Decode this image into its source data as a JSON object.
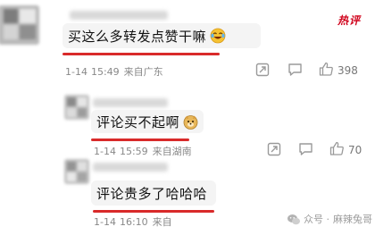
{
  "hot_badge": "热评",
  "comments": [
    {
      "text": "买这么多转发点赞干嘛",
      "date": "1-14",
      "time": "15:49",
      "location": "来自广东",
      "likes": "398",
      "emoji": "laughing-crying-emoji"
    },
    {
      "text": "评论买不起啊",
      "date": "1-14",
      "time": "15:59",
      "location": "来自湖南",
      "likes": "70",
      "emoji": "doge-emoji"
    },
    {
      "text": "评论贵多了哈哈哈",
      "date": "1-14",
      "time": "16:10",
      "location": "来自",
      "likes": ""
    }
  ],
  "watermark": {
    "prefix": "众号 ·",
    "name": "麻辣兔哥"
  },
  "colors": {
    "accent_red": "#d92a2a",
    "meta_gray": "#888888",
    "bubble_bg": "#f4f4f4"
  }
}
